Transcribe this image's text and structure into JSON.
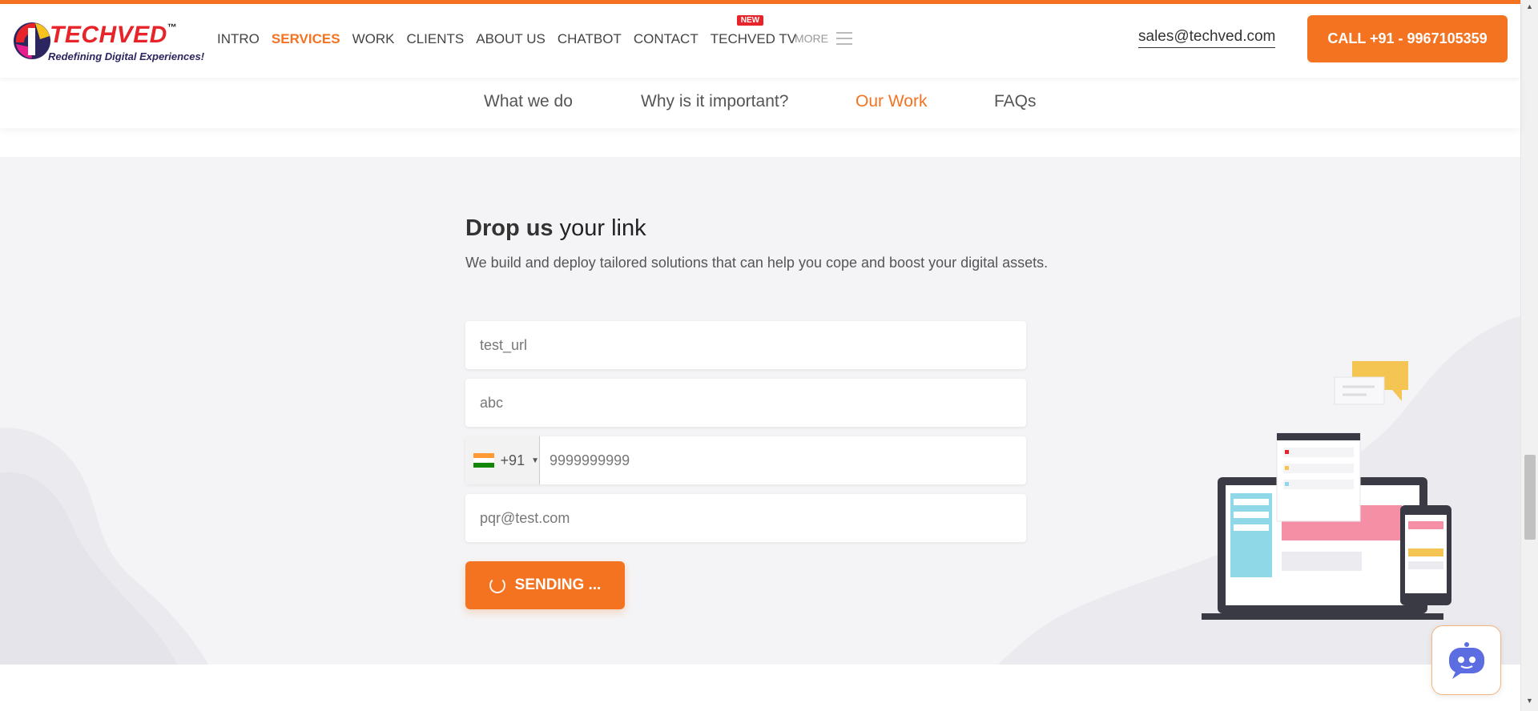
{
  "header": {
    "logo": {
      "brand": "TECHVED",
      "tm": "™",
      "tagline": "Redefining Digital Experiences!"
    },
    "nav": [
      "INTRO",
      "SERVICES",
      "WORK",
      "CLIENTS",
      "ABOUT US",
      "CHATBOT",
      "CONTACT",
      "TECHVED TV"
    ],
    "active_nav": "SERVICES",
    "new_badge": "NEW",
    "more_label": "MORE",
    "email": "sales@techved.com",
    "call_label": "CALL +91 - 9967105359"
  },
  "subnav": {
    "tabs": [
      "What we do",
      "Why is it important?",
      "Our Work",
      "FAQs"
    ],
    "active": "Our Work"
  },
  "form": {
    "title_prefix": "Drop us ",
    "title_bold": "your link",
    "description": "We build and deploy tailored solutions that can help you cope and boost your digital assets.",
    "url_value": "test_url",
    "name_value": "abc",
    "country_code": "+91",
    "phone_value": "9999999999",
    "email_value": "pqr@test.com",
    "submit_label": "SENDING ..."
  },
  "colors": {
    "accent": "#f47321",
    "brand_red": "#e8242b",
    "section_bg": "#f4f4f6"
  },
  "icons": [
    "hamburger-icon",
    "flag-india-icon",
    "caret-down-icon",
    "spinner-icon",
    "chatbot-icon"
  ]
}
